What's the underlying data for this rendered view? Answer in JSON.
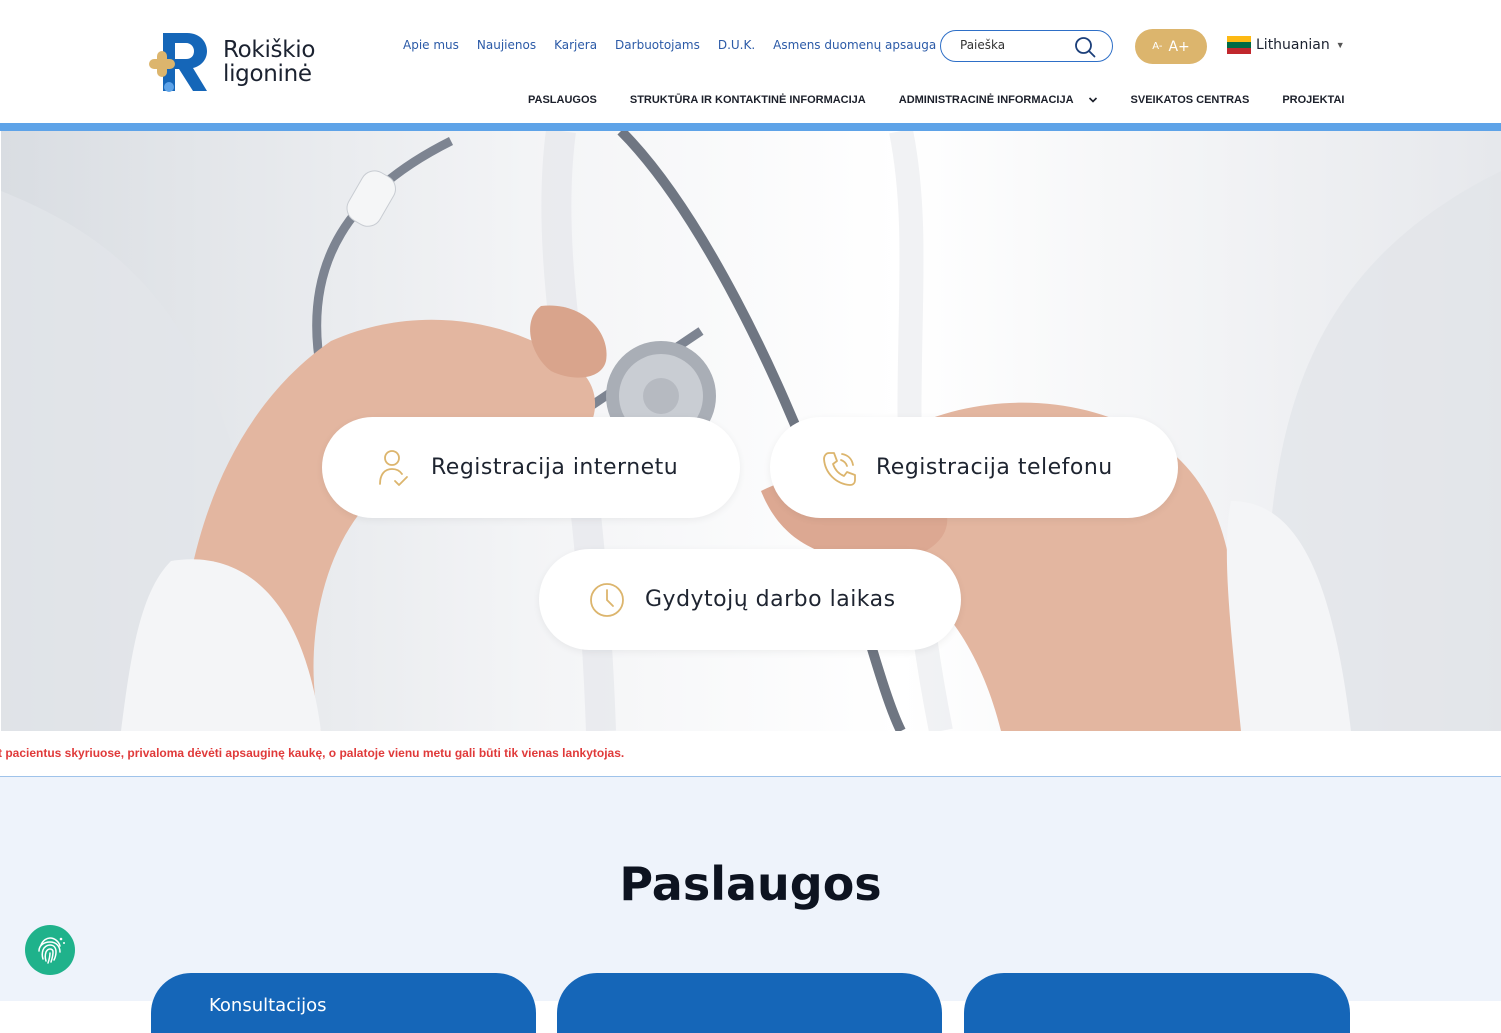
{
  "header": {
    "logo": {
      "line1": "Rokiškio",
      "line2": "ligoninė"
    },
    "top_links": [
      "Apie mus",
      "Naujienos",
      "Karjera",
      "Darbuotojams",
      "D.U.K.",
      "Asmens duomenų apsauga"
    ],
    "search": {
      "placeholder": "Paieška"
    },
    "font_size": {
      "decrease": "A-",
      "increase": "A+"
    },
    "language": {
      "label": "Lithuanian",
      "flag_colors": [
        "#fdb913",
        "#006a44",
        "#c1272d"
      ]
    },
    "main_nav": [
      "PASLAUGOS",
      "STRUKTŪRA IR KONTAKTINĖ INFORMACIJA",
      "ADMINISTRACINĖ INFORMACIJA",
      "SVEIKATOS CENTRAS",
      "PROJEKTAI"
    ]
  },
  "hero": {
    "buttons": [
      {
        "label": "Registracija internetu",
        "icon": "user-check-icon"
      },
      {
        "label": "Registracija telefonu",
        "icon": "phone-icon"
      },
      {
        "label": "Gydytojų darbo laikas",
        "icon": "clock-icon"
      }
    ]
  },
  "ticker": {
    "text": "t pacientus skyriuose, privaloma dėvėti apsauginę kaukę, o palatoje vienu metu gali būti tik vienas lankytojas."
  },
  "services": {
    "title": "Paslaugos",
    "cards": [
      {
        "label": "Konsultacijos"
      },
      {
        "label": ""
      },
      {
        "label": ""
      }
    ]
  },
  "colors": {
    "brand_blue": "#1566b8",
    "accent_gold": "#dcb56d",
    "light_blue_bar": "#5ea3e8",
    "alert_red": "#e03a3a",
    "accessibility_green": "#1fb28b"
  }
}
